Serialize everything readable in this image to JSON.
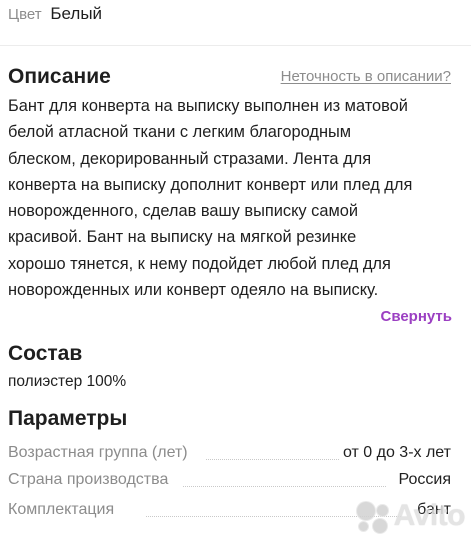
{
  "color": {
    "label": "Цвет",
    "value": "Белый"
  },
  "description": {
    "title": "Описание",
    "inaccuracy_link": "Неточность в описании?",
    "lines": [
      "Бант для конверта на выписку выполнен из матовой",
      "белой атласной ткани с легким благородным",
      "блеском, декорированный стразами. Лента для",
      "конверта на выписку дополнит конверт или плед для",
      "новорожденного, сделав вашу выписку самой",
      "красивой. Бант на выписку на мягкой резинке",
      "хорошо тянется, к нему подойдет любой плед для",
      "новорожденных или конверт одеяло на выписку."
    ],
    "collapse_label": "Свернуть"
  },
  "composition": {
    "title": "Состав",
    "value": "полиэстер 100%"
  },
  "parameters": {
    "title": "Параметры",
    "rows": [
      {
        "label": "Возрастная группа (лет)",
        "value": "от 0 до 3-х лет"
      },
      {
        "label": "Страна производства",
        "value": "Россия"
      },
      {
        "label": "Комплектация",
        "value": "бант"
      }
    ]
  },
  "watermark": {
    "text": "Avito",
    "icon": "avito-logo-dots"
  },
  "colors": {
    "accent": "#9b3fc2",
    "muted": "#8c8c8c",
    "text": "#1f1f1f"
  }
}
